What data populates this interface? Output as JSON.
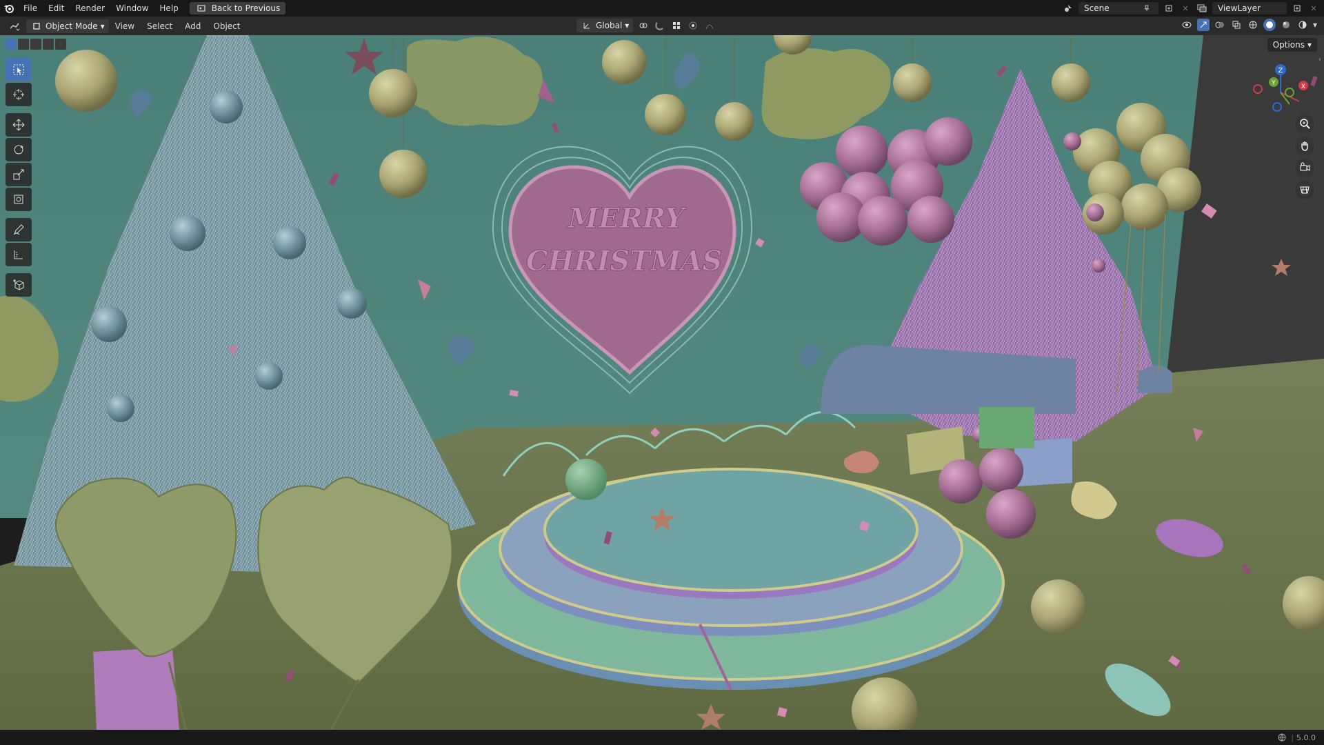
{
  "topbar": {
    "menus": [
      "File",
      "Edit",
      "Render",
      "Window",
      "Help"
    ],
    "back_button": "Back to Previous",
    "scene_name": "Scene",
    "view_layer": "ViewLayer"
  },
  "header": {
    "mode": "Object Mode",
    "menus": [
      "View",
      "Select",
      "Add",
      "Object"
    ],
    "transform_orientation": "Global"
  },
  "viewport": {
    "options_label": "Options",
    "scene_text_line1": "MERRY",
    "scene_text_line2": "CHRISTMAS",
    "gizmo_axes": {
      "z": "Z",
      "y": "Y",
      "x": "X"
    }
  },
  "statusbar": {
    "version": "5.0.0"
  },
  "colors": {
    "accent": "#4772b3",
    "wall": "#4e857c",
    "floor": "#6e7a4e",
    "tree_blue": "#7f9ea8",
    "tree_purple": "#a47ab5",
    "heart": "#a0698e",
    "gold": "#b1ad7a"
  }
}
